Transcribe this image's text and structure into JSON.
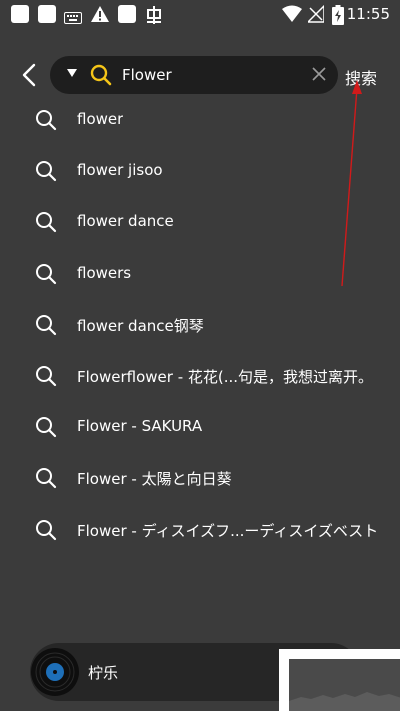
{
  "status_bar": {
    "time": "11:55"
  },
  "search": {
    "value": "Flower",
    "button_label": "搜索"
  },
  "suggestions": [
    "flower",
    "flower jisoo",
    "flower dance",
    "flowers",
    "flower dance钢琴",
    "Flowerflower - 花花(...句是，我想过离开。",
    "Flower - SAKURA",
    "Flower - 太陽と向日葵",
    "Flower - ディスイズフ...ーディスイズベスト"
  ],
  "player": {
    "title": "柠乐"
  },
  "colors": {
    "background": "#3b3b3b",
    "search_pill": "#1e1e1e",
    "accent": "#f5c518",
    "annotation": "#d11a1a"
  }
}
